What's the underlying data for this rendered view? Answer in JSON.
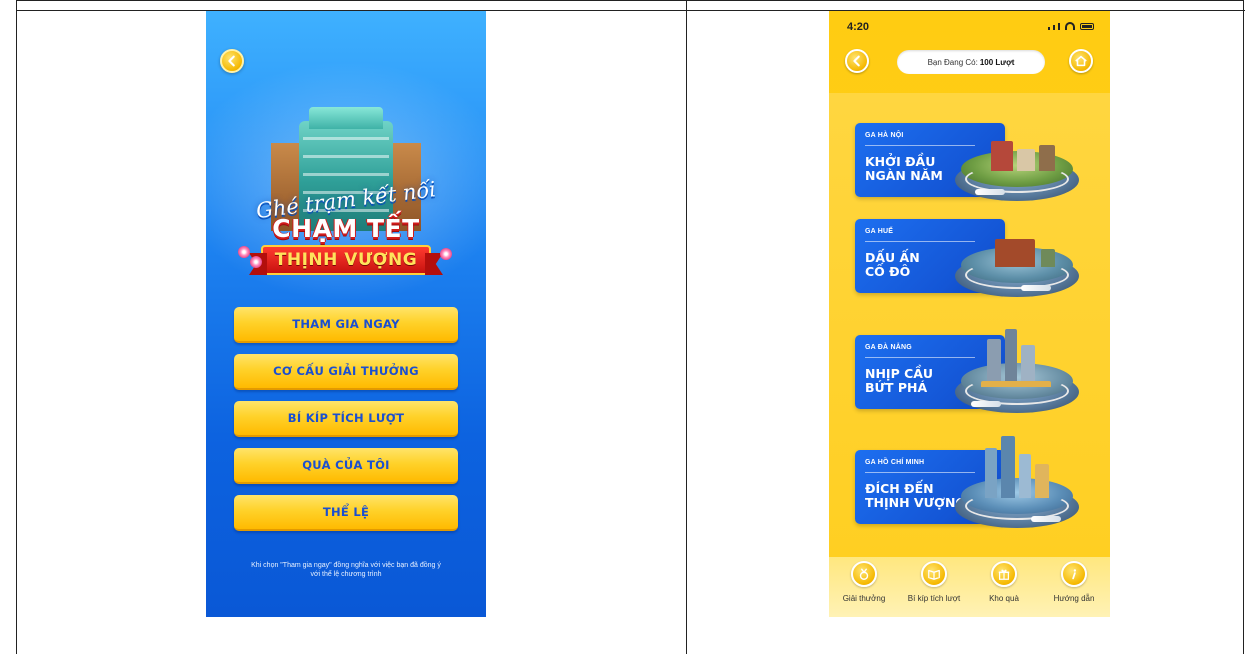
{
  "left_screen": {
    "title_script": "Ghé trạm kết nối",
    "title_line1": "CHẠM TẾT",
    "title_line2": "THỊNH VƯỢNG",
    "menu": [
      {
        "label": "THAM GIA NGAY"
      },
      {
        "label": "CƠ CẤU GIẢI THƯỞNG"
      },
      {
        "label": "BÍ KÍP TÍCH LƯỢT"
      },
      {
        "label": "QUÀ CỦA TÔI"
      },
      {
        "label": "THỂ LỆ"
      }
    ],
    "disclaimer_line1": "Khi chọn \"Tham gia ngay\" đồng nghĩa với việc bạn đã đồng ý",
    "disclaimer_line2": "với thể lệ chương trình"
  },
  "right_screen": {
    "status_time": "4:20",
    "counter_prefix": "Bạn Đang Có:",
    "counter_value": "100 Lượt",
    "stations": [
      {
        "label": "GA HÀ NỘI",
        "name_line1": "KHỞI ĐẦU",
        "name_line2": "NGÀN NĂM"
      },
      {
        "label": "GA HUẾ",
        "name_line1": "DẤU ẤN",
        "name_line2": "CỐ ĐÔ"
      },
      {
        "label": "GA ĐÀ NẴNG",
        "name_line1": "NHỊP CẦU",
        "name_line2": "BỨT PHÁ"
      },
      {
        "label": "GA HỒ CHÍ MINH",
        "name_line1": "ĐÍCH ĐẾN",
        "name_line2": "THỊNH VƯỢNG"
      }
    ],
    "tabs": [
      {
        "label": "Giải thưởng",
        "icon": "medal-icon"
      },
      {
        "label": "Bí kíp tích lượt",
        "icon": "book-icon"
      },
      {
        "label": "Kho quà",
        "icon": "gift-icon"
      },
      {
        "label": "Hướng dẫn",
        "icon": "info-icon"
      }
    ]
  },
  "colors": {
    "left_bg": "#1f86f2",
    "button_gold": "#ffd22a",
    "button_text": "#1a4fd1",
    "right_bg": "#ffcc12",
    "station_card": "#1d6ff0"
  }
}
